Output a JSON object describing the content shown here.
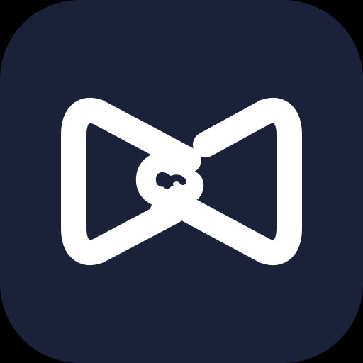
{
  "app_icon": {
    "logo": "bowtie-chain-link-logo-icon",
    "colors": {
      "background": "#1a2139",
      "outer": "#000000",
      "glyph": "#ffffff"
    }
  }
}
